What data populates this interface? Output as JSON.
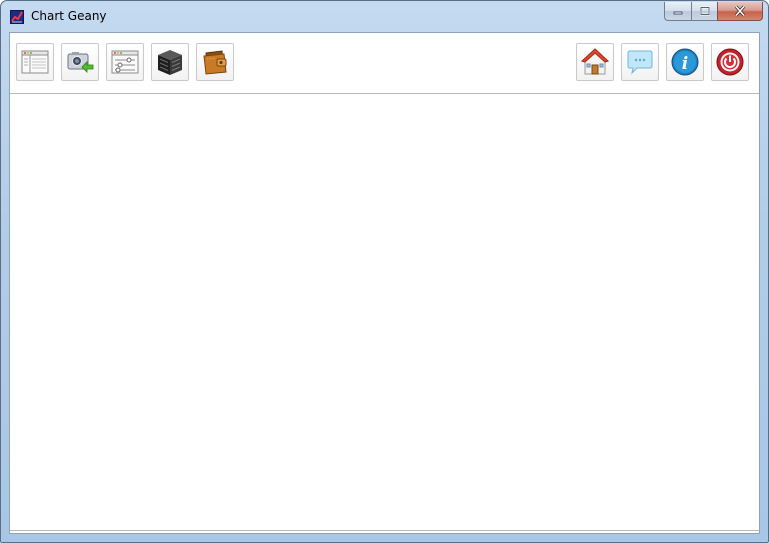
{
  "window": {
    "title": "Chart Geany",
    "app_icon": "chart-app-icon",
    "caption_buttons": [
      "minimize-icon",
      "maximize-icon",
      "close-icon"
    ]
  },
  "toolbar": {
    "left_buttons": [
      {
        "icon": "table-view-icon"
      },
      {
        "icon": "camera-export-icon"
      },
      {
        "icon": "settings-sliders-icon"
      },
      {
        "icon": "database-cube-icon"
      },
      {
        "icon": "wallet-icon"
      }
    ],
    "right_buttons": [
      {
        "icon": "home-icon"
      },
      {
        "icon": "chat-bubble-icon"
      },
      {
        "icon": "info-icon"
      },
      {
        "icon": "power-off-icon"
      }
    ]
  },
  "colors": {
    "titlebar": "#b3cde8",
    "close_button": "#c7614c",
    "info_blue": "#1f7fc2",
    "power_red": "#c8202a"
  }
}
